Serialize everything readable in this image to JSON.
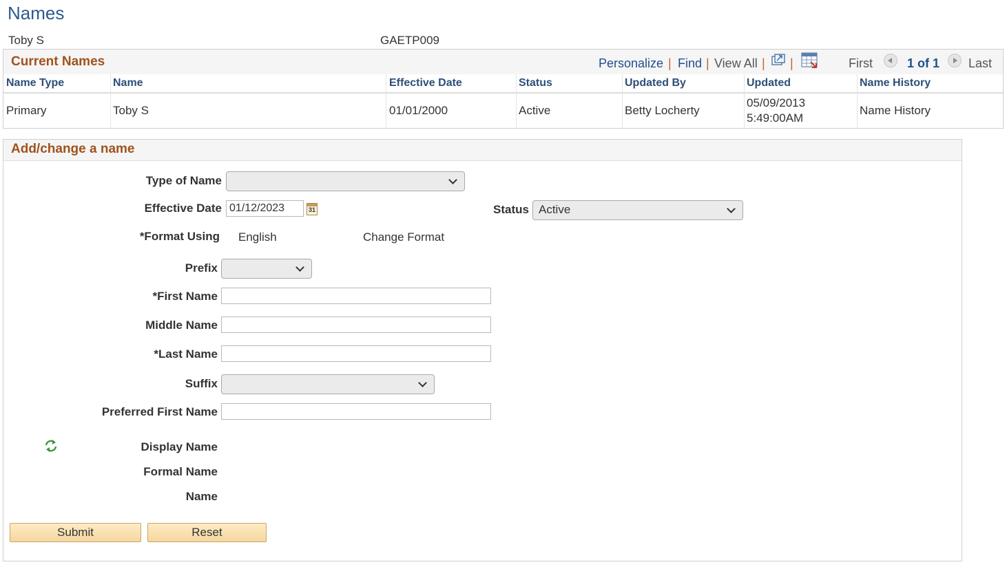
{
  "page": {
    "title": "Names"
  },
  "person": {
    "name": "Toby S",
    "id": "GAETP009"
  },
  "current_names": {
    "title": "Current Names",
    "nav": {
      "personalize": "Personalize",
      "find": "Find",
      "view_all": "View All",
      "sep": "|",
      "first": "First",
      "count": "1 of 1",
      "last": "Last"
    },
    "columns": [
      "Name Type",
      "Name",
      "Effective Date",
      "Status",
      "Updated By",
      "Updated",
      "Name History"
    ],
    "rows": [
      {
        "name_type": "Primary",
        "name": "Toby S",
        "effective_date": "01/01/2000",
        "status": "Active",
        "updated_by": "Betty Locherty",
        "updated_date": "05/09/2013",
        "updated_time": "5:49:00AM",
        "name_history": "Name History"
      }
    ]
  },
  "form": {
    "title": "Add/change a name",
    "type_of_name": {
      "label": "Type of Name",
      "value": ""
    },
    "effective_date": {
      "label": "Effective Date",
      "value": "01/12/2023"
    },
    "status": {
      "label": "Status",
      "value": "Active"
    },
    "format_using": {
      "label": "*Format Using",
      "value": "English",
      "change_link": "Change Format"
    },
    "prefix": {
      "label": "Prefix",
      "value": ""
    },
    "first_name": {
      "label": "*First Name",
      "value": ""
    },
    "middle_name": {
      "label": "Middle Name",
      "value": ""
    },
    "last_name": {
      "label": "*Last Name",
      "value": ""
    },
    "suffix": {
      "label": "Suffix",
      "value": ""
    },
    "preferred_first_name": {
      "label": "Preferred First Name",
      "value": ""
    },
    "display_name": {
      "label": "Display Name"
    },
    "formal_name": {
      "label": "Formal Name"
    },
    "name": {
      "label": "Name"
    },
    "buttons": {
      "submit": "Submit",
      "reset": "Reset"
    },
    "calendar_day": "31"
  },
  "icons": [
    "zoom-out-icon",
    "download-grid-icon",
    "prev-icon",
    "next-icon",
    "calendar-icon",
    "refresh-icon"
  ],
  "colors": {
    "link": "#1f4f8c",
    "section_title": "#a0521d",
    "page_title": "#2c5a8c",
    "button": "#f5d79f"
  }
}
